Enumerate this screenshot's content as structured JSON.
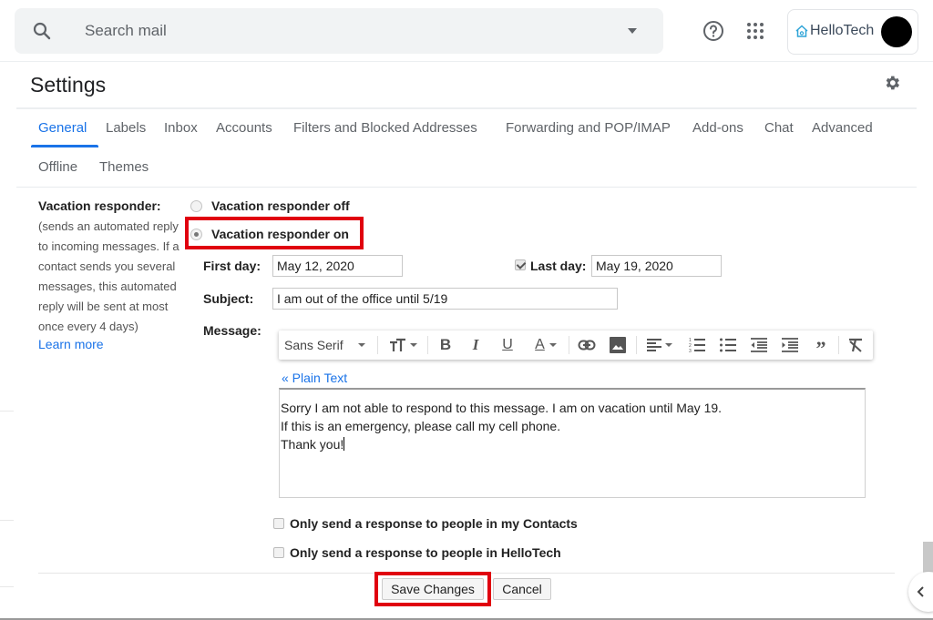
{
  "topbar": {
    "search_placeholder": "Search mail",
    "icons": [
      "search-icon",
      "search-options-dropdown-icon",
      "help-icon",
      "apps-grid-icon"
    ],
    "account": {
      "org_name": "HelloTech",
      "logo_icon": "house-icon",
      "avatar_color": "#000000"
    }
  },
  "settings": {
    "title": "Settings",
    "gear_icon": "gear-icon",
    "tabs": [
      {
        "label": "General",
        "active": true
      },
      {
        "label": "Labels",
        "active": false
      },
      {
        "label": "Inbox",
        "active": false
      },
      {
        "label": "Accounts",
        "active": false
      },
      {
        "label": "Filters and Blocked Addresses",
        "active": false
      },
      {
        "label": "Forwarding and POP/IMAP",
        "active": false
      },
      {
        "label": "Add-ons",
        "active": false
      },
      {
        "label": "Chat",
        "active": false
      },
      {
        "label": "Advanced",
        "active": false
      },
      {
        "label": "Offline",
        "active": false
      },
      {
        "label": "Themes",
        "active": false
      }
    ]
  },
  "vacation": {
    "label": "Vacation responder:",
    "description_lines": [
      "(sends an automated reply",
      "to incoming messages. If a",
      "contact sends you several",
      "messages, this automated",
      "reply will be sent at most",
      "once every 4 days)"
    ],
    "learn_more": "Learn more",
    "options": [
      {
        "label": "Vacation responder off",
        "selected": false
      },
      {
        "label": "Vacation responder on",
        "selected": true
      }
    ],
    "first_day_label": "First day:",
    "first_day_value": "May 12, 2020",
    "last_day_label": "Last day:",
    "last_day_enabled": true,
    "last_day_value": "May 19, 2020",
    "subject_label": "Subject:",
    "subject_value": "I am out of the office until 5/19",
    "message_label": "Message:",
    "toolbar": {
      "font": "Sans Serif",
      "buttons": [
        "text-size",
        "bold",
        "italic",
        "underline",
        "text-color",
        "link",
        "image",
        "align",
        "numbered-list",
        "bulleted-list",
        "indent-less",
        "indent-more",
        "quote",
        "remove-formatting"
      ]
    },
    "plain_text_link": "« Plain Text",
    "message_lines": [
      "Sorry I am not able to respond to this message. I am on vacation until May 19.",
      "If this is an emergency, please call my cell phone.",
      "Thank you!"
    ],
    "contacts_only_label": "Only send a response to people in my Contacts",
    "contacts_only_checked": false,
    "org_only_label": "Only send a response to people in HelloTech",
    "org_only_checked": false
  },
  "actions": {
    "save": "Save Changes",
    "cancel": "Cancel"
  },
  "annotation": {
    "highlight_color": "#e0000f"
  },
  "colors": {
    "accent": "#1a73e8"
  }
}
